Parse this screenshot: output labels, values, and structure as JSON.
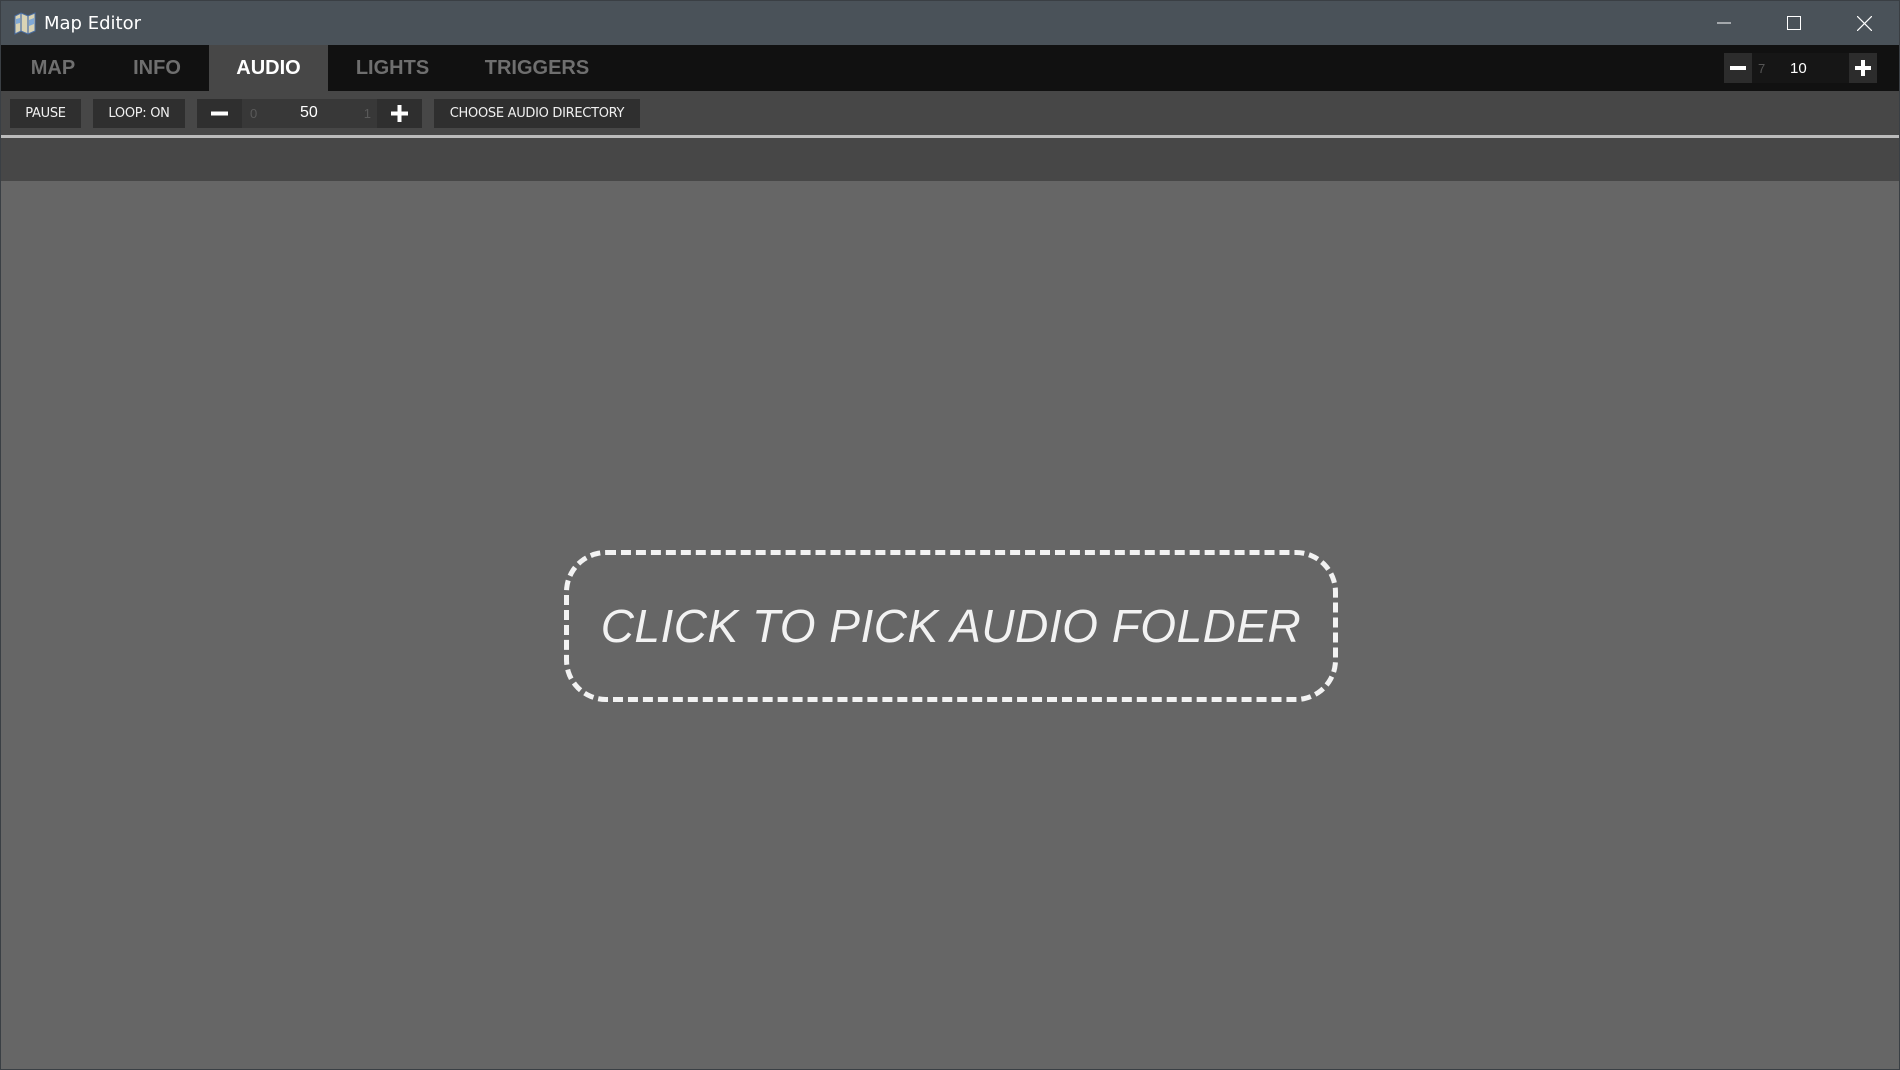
{
  "window": {
    "title": "Map Editor",
    "icon": "map-icon",
    "controls": [
      "minimize-icon",
      "maximize-icon",
      "close-icon"
    ]
  },
  "tabs": [
    {
      "label": "MAP",
      "active": false
    },
    {
      "label": "INFO",
      "active": false
    },
    {
      "label": "AUDIO",
      "active": true
    },
    {
      "label": "LIGHTS",
      "active": false
    },
    {
      "label": "TRIGGERS",
      "active": false
    }
  ],
  "zoom": {
    "min": "7",
    "value": "10"
  },
  "toolbar": {
    "pause_label": "PAUSE",
    "loop_label": "LOOP: ON",
    "volume": {
      "min": "0",
      "value": "50",
      "max": "1"
    },
    "choose_dir_label": "CHOOSE AUDIO DIRECTORY"
  },
  "main": {
    "drop_label": "CLICK TO PICK AUDIO FOLDER"
  },
  "colors": {
    "titlebar": "#4a5259",
    "tabbar": "#111111",
    "active_tab": "#474747",
    "workspace": "#666666"
  }
}
